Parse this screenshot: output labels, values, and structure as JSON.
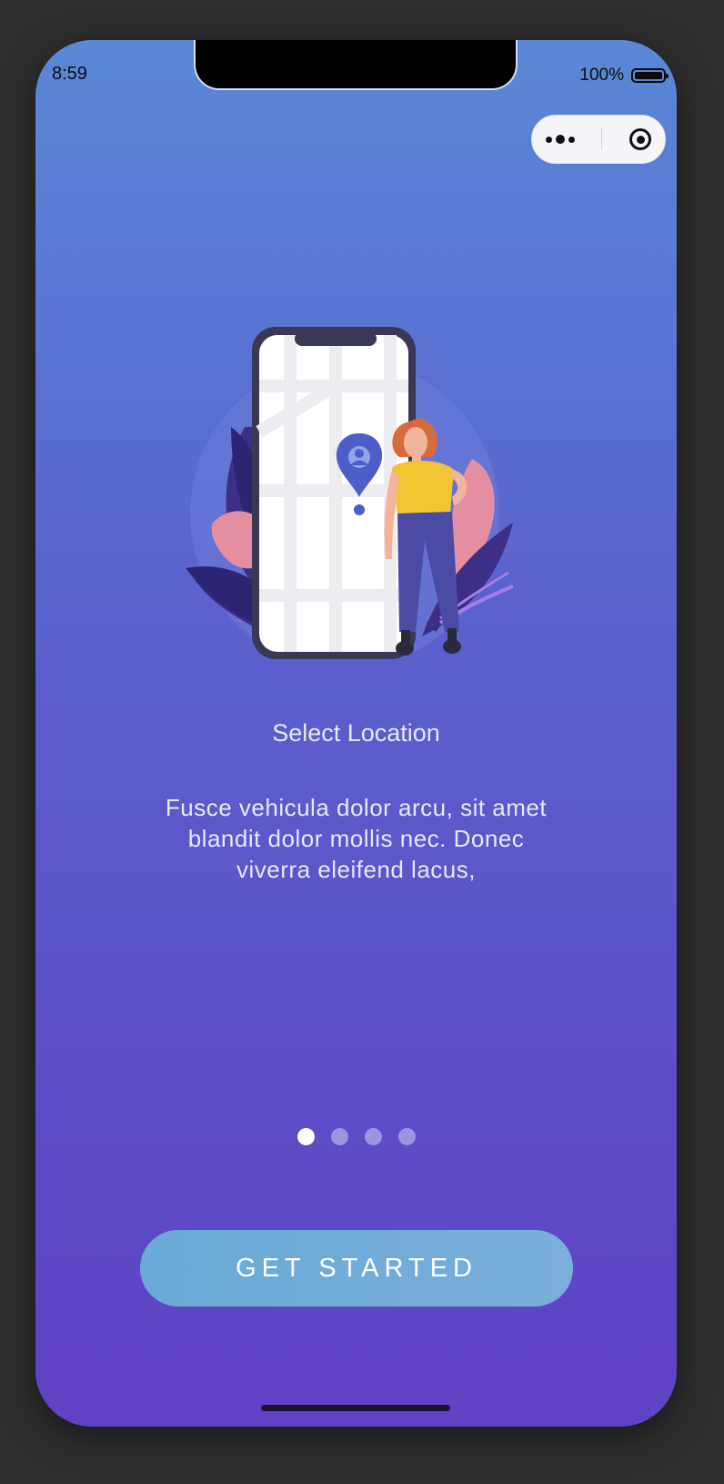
{
  "status_bar": {
    "time": "8:59",
    "battery": "100%"
  },
  "capsule": {
    "more_icon": "more-dots-icon",
    "close_icon": "target-icon"
  },
  "onboarding": {
    "title": "Select Location",
    "description": "Fusce vehicula dolor arcu, sit amet blandit dolor mollis nec. Donec viverra eleifend lacus,",
    "pages_total": 4,
    "current_page": 1
  },
  "cta": {
    "label": "GET STARTED"
  },
  "colors": {
    "background_top": "#5a88d6",
    "background_bottom": "#6041c4",
    "cta": "#72abd9",
    "dot_active": "#ffffff",
    "dot_inactive": "#9a94e2"
  }
}
